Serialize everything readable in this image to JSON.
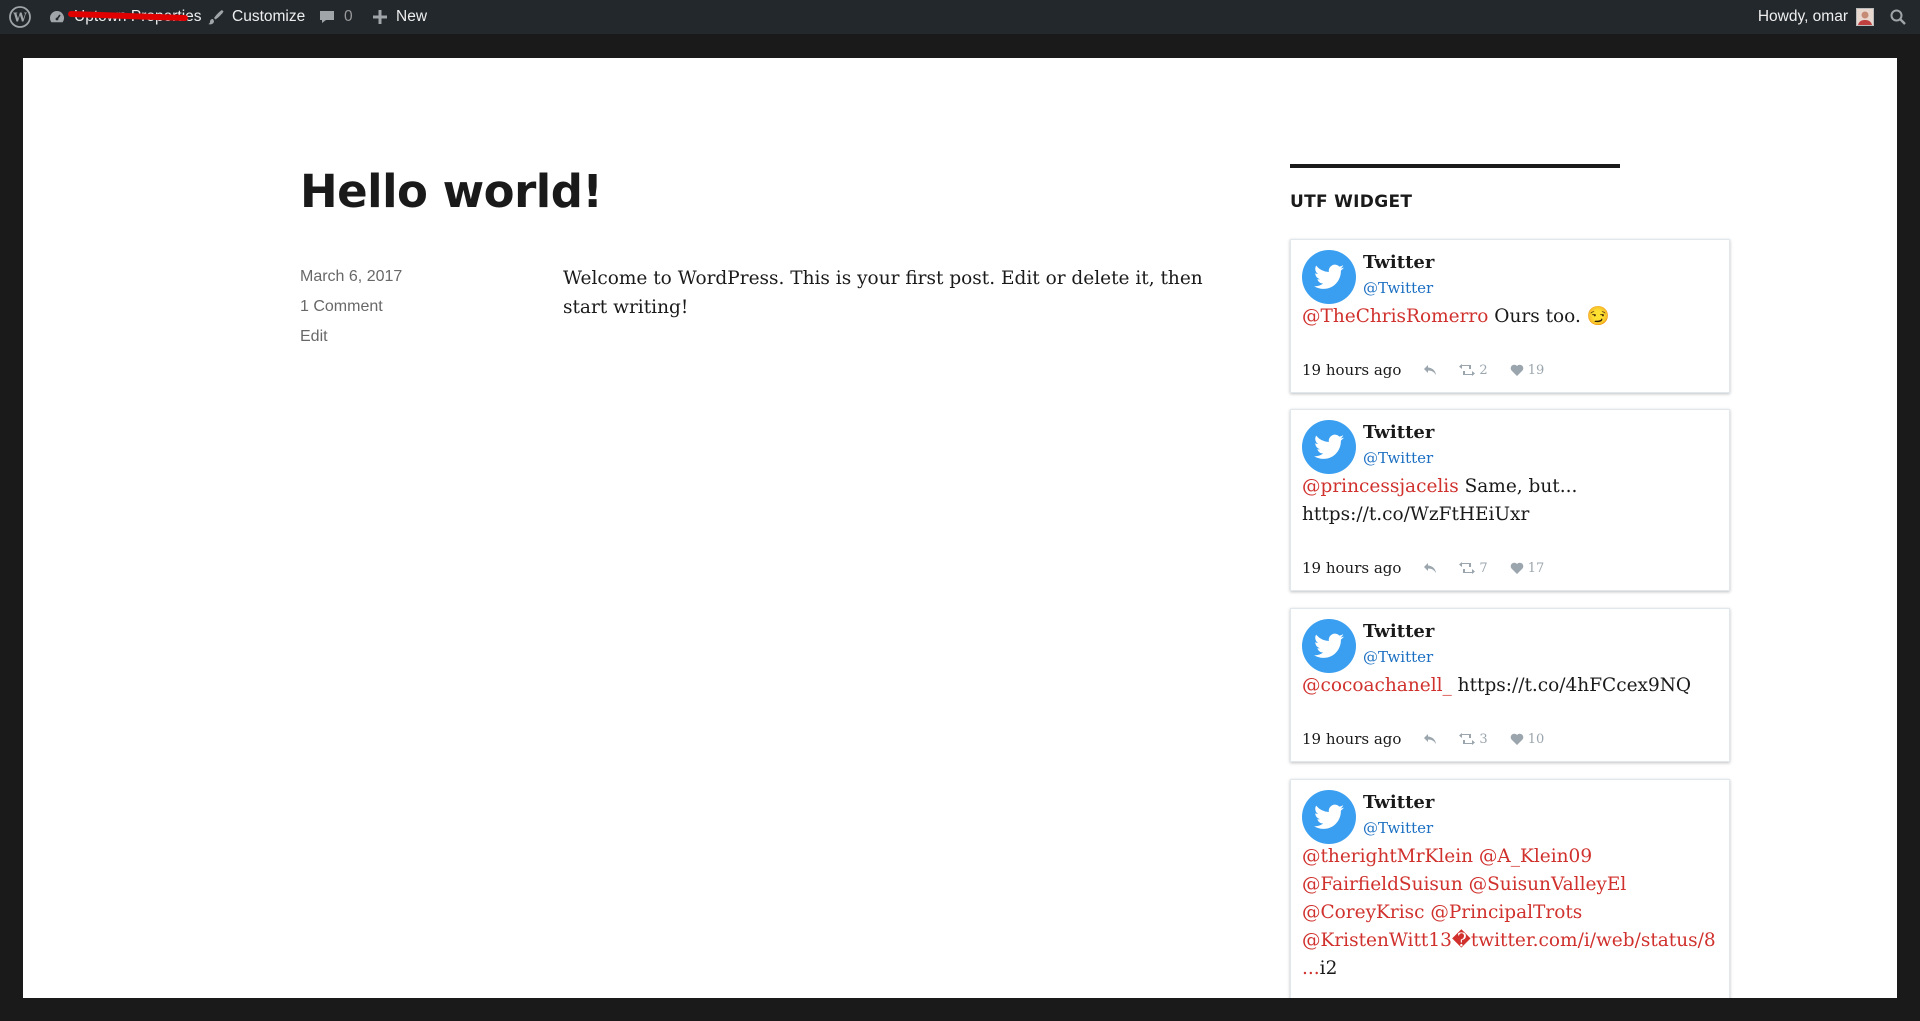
{
  "adminbar": {
    "site_name": "Uptown Properties",
    "customize": "Customize",
    "comments_count": "0",
    "new": "New",
    "howdy": "Howdy, omar"
  },
  "post": {
    "title": "Hello world!",
    "date": "March 6, 2017",
    "comments_link": "1 Comment",
    "edit_link": "Edit",
    "content": "Welcome to WordPress. This is your first post. Edit or delete it, then start writing!"
  },
  "widget": {
    "title": "UTF WIDGET",
    "tweets": [
      {
        "name": "Twitter",
        "handle": "@Twitter",
        "mention": "@TheChrisRomerro",
        "text": " Ours too. 😏",
        "time": "19 hours ago",
        "retweets": "2",
        "likes": "19"
      },
      {
        "name": "Twitter",
        "handle": "@Twitter",
        "mention": "@princessjacelis",
        "text": " Same, but... https://t.co/WzFtHEiUxr",
        "time": "19 hours ago",
        "retweets": "7",
        "likes": "17"
      },
      {
        "name": "Twitter",
        "handle": "@Twitter",
        "mention": "@cocoachanell_",
        "text": " https://t.co/4hFCcex9NQ",
        "time": "19 hours ago",
        "retweets": "3",
        "likes": "10"
      },
      {
        "name": "Twitter",
        "handle": "@Twitter",
        "mention": "@therightMrKlein @A_Klein09 @FairfieldSuisun @SuisunValleyEl @CoreyKrisc @PrincipalTrots @KristenWitt13�twitter.com/i/web/status/8...",
        "text": "i2",
        "time": "",
        "retweets": "",
        "likes": ""
      }
    ]
  }
}
